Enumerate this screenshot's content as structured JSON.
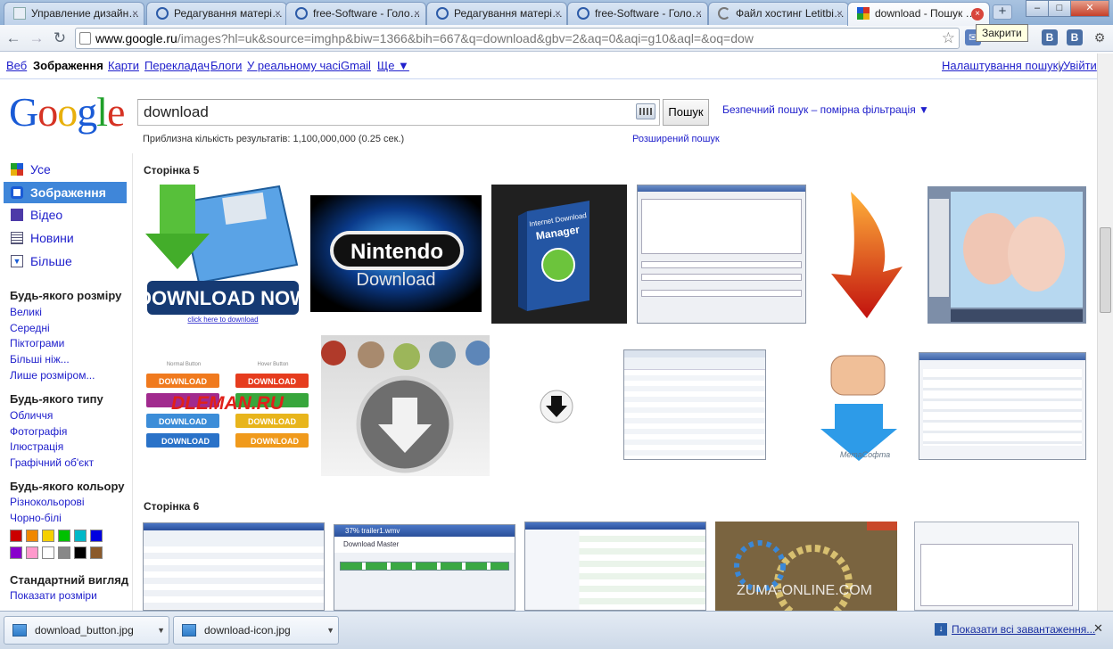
{
  "browser": {
    "tabs": [
      {
        "label": "Управление дизайн…",
        "favicon": "page-icon",
        "close": "×"
      },
      {
        "label": "Редагування матері…",
        "favicon": "joomla-icon",
        "close": "×"
      },
      {
        "label": "free-Software - Голо…",
        "favicon": "joomla-icon",
        "close": "×"
      },
      {
        "label": "Редагування матері…",
        "favicon": "joomla-icon",
        "close": "×"
      },
      {
        "label": "free-Software - Голо…",
        "favicon": "joomla-icon",
        "close": "×"
      },
      {
        "label": "Файл хостинг Letitbi…",
        "favicon": "loading-icon",
        "close": "×"
      },
      {
        "label": "download - Пошук …",
        "favicon": "google-icon",
        "close": "×"
      }
    ],
    "new_tab": "+",
    "window_controls": {
      "minimize": "–",
      "maximize": "□",
      "close": "✕"
    },
    "url_host": "www.google.ru",
    "url_path": "/images?hl=uk&source=imghp&biw=1366&bih=667&q=download&gbv=2&aq=0&aqi=g10&aql=&oq=dow",
    "star": "☆",
    "tooltip": "Закрити",
    "extensions": [
      {
        "label": "✉",
        "color": "#5a7fbf"
      },
      {
        "label": "B",
        "color": "#4a6fa5"
      },
      {
        "label": "B",
        "color": "#4a6fa5"
      }
    ],
    "nav": {
      "back": "←",
      "forward": "→",
      "reload": "↻"
    }
  },
  "gbar": {
    "links": [
      {
        "label": "Веб",
        "selected": false
      },
      {
        "label": "Зображення",
        "selected": true
      },
      {
        "label": "Карти",
        "selected": false
      },
      {
        "label": "Перекладач",
        "selected": false
      },
      {
        "label": "Блоги",
        "selected": false
      },
      {
        "label": "У реальному часі",
        "selected": false
      },
      {
        "label": "Gmail",
        "selected": false
      },
      {
        "label": "Ще ▼",
        "selected": false
      }
    ],
    "settings": "Налаштування пошуку",
    "separator": "|",
    "signin": "Увійти"
  },
  "logo": {
    "letters": [
      "G",
      "o",
      "o",
      "g",
      "l",
      "e"
    ]
  },
  "search": {
    "query": "download",
    "button": "Пошук",
    "safesearch": "Безпечний пошук – помірна фільтрація ▼",
    "stats": "Приблизна кількість результатів: 1,100,000,000 (0.25 сек.)",
    "advanced": "Розширений пошук"
  },
  "sidebar": {
    "nav": [
      {
        "label": "Усе",
        "icon": "colored-squares-icon",
        "active": false
      },
      {
        "label": "Зображення",
        "icon": "camera-icon",
        "active": true
      },
      {
        "label": "Відео",
        "icon": "film-icon",
        "active": false
      },
      {
        "label": "Новини",
        "icon": "newspaper-icon",
        "active": false
      },
      {
        "label": "Більше",
        "icon": "chevron-down-icon",
        "active": false
      }
    ],
    "size_title": "Будь-якого розміру",
    "size_links": [
      "Великі",
      "Середні",
      "Піктограми",
      "Більші ніж...",
      "Лише розміром..."
    ],
    "type_title": "Будь-якого типу",
    "type_links": [
      "Обличчя",
      "Фотографія",
      "Ілюстрація",
      "Графічний об'єкт"
    ],
    "color_title": "Будь-якого кольору",
    "color_links": [
      "Різнокольорові",
      "Чорно-білі"
    ],
    "swatches": [
      "#cc0000",
      "#f08800",
      "#f5d000",
      "#00c000",
      "#00b8c8",
      "#0000e0",
      "#8800cc",
      "#ff99cc",
      "#ffffff",
      "#888888",
      "#000000",
      "#8b5a2b"
    ],
    "view_title": "Стандартний вигляд",
    "view_link": "Показати розміри"
  },
  "results": {
    "page5_heading": "Сторінка 5",
    "page6_heading": "Сторінка 6",
    "thumb_texts": {
      "download_now": "DOWNLOAD NOW",
      "click_here": "click here to download",
      "nintendo": "Nintendo",
      "nintendo_sub": "Download",
      "idm_1": "Internet Download",
      "idm_2": "Manager",
      "dleman": "DLEMAN.RU",
      "normal_button": "Normal Button",
      "hover_button": "Hover Button",
      "download_word": "DOWNLOAD",
      "meta_soft": "МетаСофта",
      "zuma": "ZUMA-ONLINE.COM",
      "wmv_title": "37% trailer1.wmv",
      "dm_title": "Download Master"
    }
  },
  "shelf": {
    "items": [
      "download_button.jpg",
      "download-icon.jpg"
    ],
    "show_all": "Показати всі завантаження...",
    "close": "✕"
  }
}
